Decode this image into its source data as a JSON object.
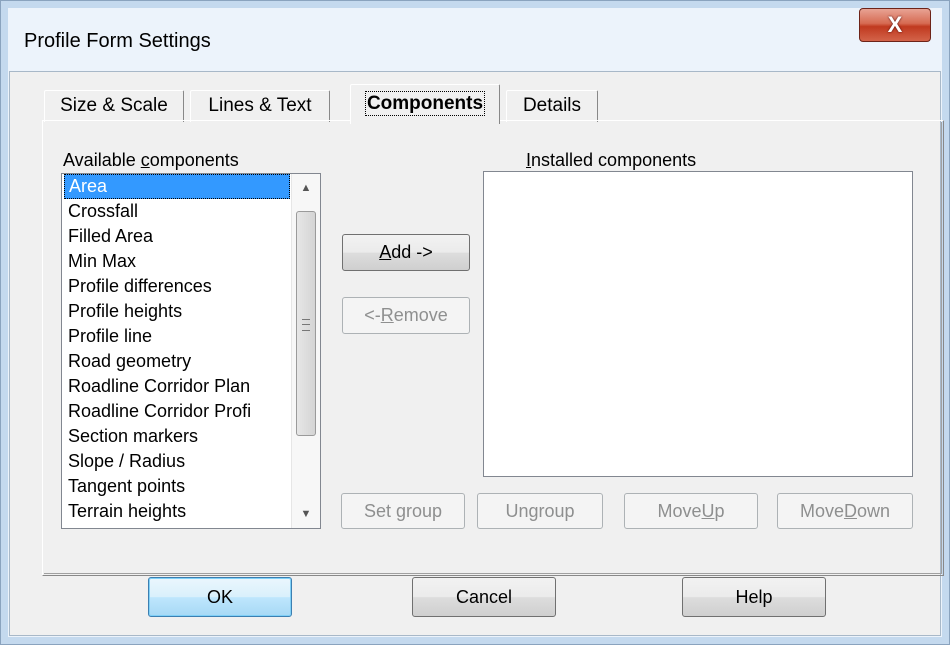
{
  "window": {
    "title": "Profile Form Settings",
    "close_glyph": "X"
  },
  "tabs": [
    {
      "label": "Size & Scale"
    },
    {
      "label": "Lines & Text"
    },
    {
      "label": "Components"
    },
    {
      "label": "Details"
    }
  ],
  "available": {
    "label_pre": "Available ",
    "label_ul": "c",
    "label_post": "omponents",
    "items": [
      "Area",
      "Crossfall",
      "Filled Area",
      "Min Max",
      "Profile differences",
      "Profile heights",
      "Profile line",
      "Road geometry",
      "Roadline Corridor Plan",
      "Roadline Corridor Profi",
      "Section markers",
      "Slope / Radius",
      "Tangent points",
      "Terrain heights"
    ],
    "selected_index": 0
  },
  "installed": {
    "label_ul": "I",
    "label_post": "nstalled components",
    "items": []
  },
  "buttons": {
    "add": {
      "ul": "A",
      "rest": "dd ->"
    },
    "remove": {
      "pre": "<- ",
      "ul": "R",
      "rest": "emove"
    },
    "set_group": "Set group",
    "ungroup": "Ungroup",
    "move_up": {
      "pre": "Move ",
      "ul": "U",
      "rest": "p"
    },
    "move_down": {
      "pre": "Move ",
      "ul": "D",
      "rest": "own"
    },
    "ok": "OK",
    "cancel": "Cancel",
    "help": "Help"
  }
}
